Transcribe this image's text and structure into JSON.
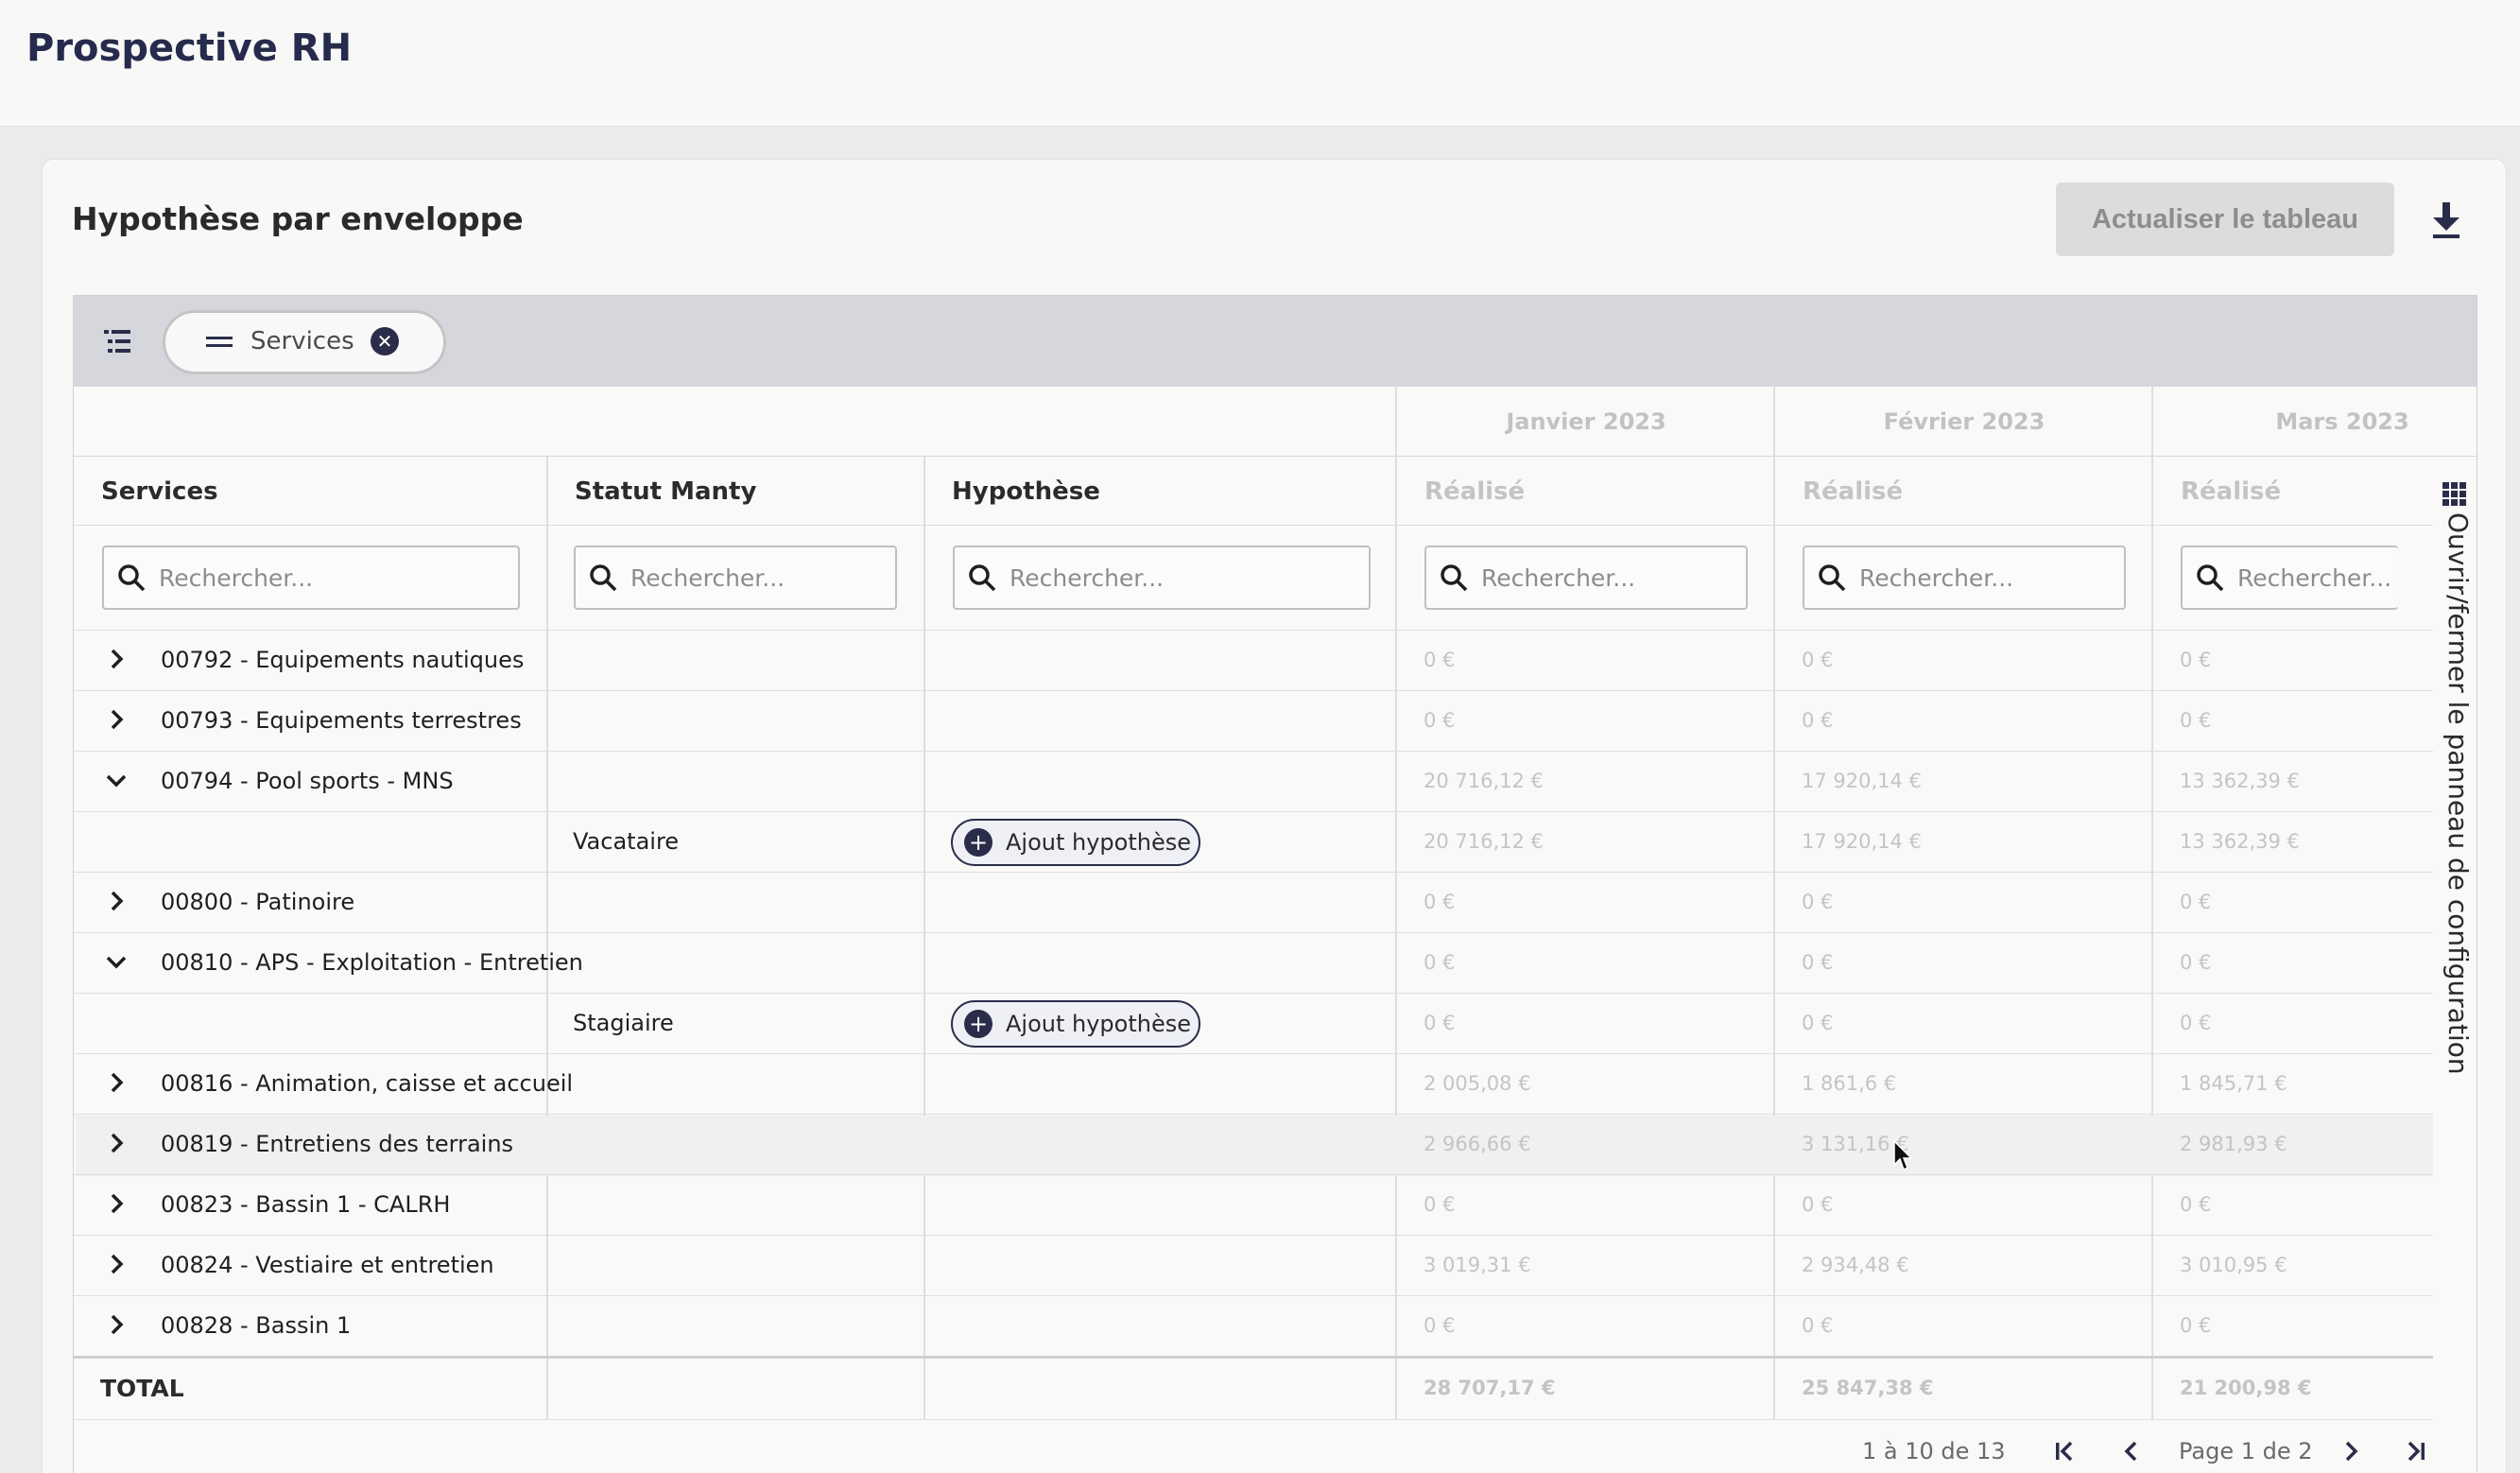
{
  "app": {
    "title": "Prospective RH"
  },
  "card": {
    "title": "Hypothèse par enveloppe",
    "refresh_label": "Actualiser le tableau"
  },
  "groupPanel": {
    "chip_label": "Services"
  },
  "months": [
    "Janvier 2023",
    "Février 2023",
    "Mars 2023"
  ],
  "columns": {
    "services": "Services",
    "statut": "Statut Manty",
    "hypothese": "Hypothèse",
    "realise": "Réalisé"
  },
  "search": {
    "placeholder": "Rechercher..."
  },
  "rows": [
    {
      "label": "00792 - Equipements nautiques",
      "vals": [
        "0 €",
        "0 €",
        "0 €"
      ]
    },
    {
      "label": "00793 - Equipements terrestres",
      "vals": [
        "0 €",
        "0 €",
        "0 €"
      ]
    },
    {
      "label": "00794 - Pool sports - MNS",
      "vals": [
        "20 716,12 €",
        "17 920,14 €",
        "13 362,39 €"
      ]
    },
    {
      "statut": "Vacataire",
      "action": "Ajout hypothèse",
      "vals": [
        "20 716,12 €",
        "17 920,14 €",
        "13 362,39 €"
      ]
    },
    {
      "label": "00800 - Patinoire",
      "vals": [
        "0 €",
        "0 €",
        "0 €"
      ]
    },
    {
      "label": "00810 - APS - Exploitation - Entretien",
      "vals": [
        "0 €",
        "0 €",
        "0 €"
      ]
    },
    {
      "statut": "Stagiaire",
      "action": "Ajout hypothèse",
      "vals": [
        "0 €",
        "0 €",
        "0 €"
      ]
    },
    {
      "label": "00816 - Animation, caisse et accueil",
      "vals": [
        "2 005,08 €",
        "1 861,6 €",
        "1 845,71 €"
      ]
    },
    {
      "label": "00819 - Entretiens des terrains",
      "vals": [
        "2 966,66 €",
        "3 131,16 €",
        "2 981,93 €"
      ]
    },
    {
      "label": "00823 - Bassin 1 - CALRH",
      "vals": [
        "0 €",
        "0 €",
        "0 €"
      ]
    },
    {
      "label": "00824 - Vestiaire et entretien",
      "vals": [
        "3 019,31 €",
        "2 934,48 €",
        "3 010,95 €"
      ]
    },
    {
      "label": "00828 - Bassin 1",
      "vals": [
        "0 €",
        "0 €",
        "0 €"
      ]
    }
  ],
  "total": {
    "label": "TOTAL",
    "vals": [
      "28 707,17 €",
      "25 847,38 €",
      "21 200,98 €"
    ]
  },
  "side_panel": {
    "label": "Ouvrir/fermer le panneau de configuration"
  },
  "pagination": {
    "range": "1 à 10 de 13",
    "page": "Page 1 de 2"
  },
  "colors": {
    "navy": "#2a2d4a",
    "muted": "#c4c4c4"
  },
  "icons": [
    "list-tree-icon",
    "drag-bars-icon",
    "close-icon",
    "search-icon",
    "chevron-right-icon",
    "chevron-down-icon",
    "plus-icon",
    "download-icon",
    "grid-icon",
    "first-page-icon",
    "prev-page-icon",
    "next-page-icon",
    "last-page-icon"
  ]
}
